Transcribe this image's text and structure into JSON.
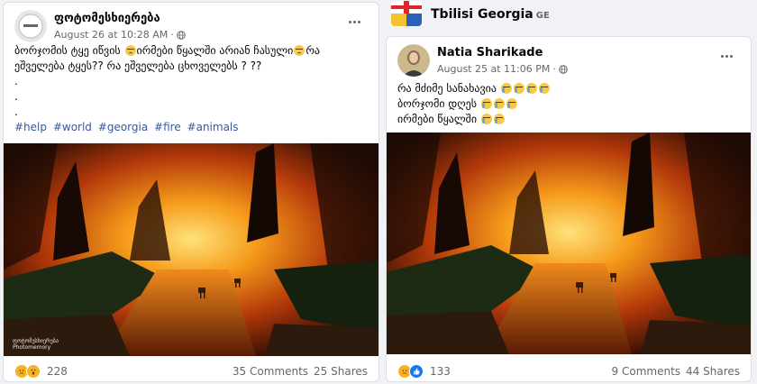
{
  "left_post": {
    "author": "ფოტომესხიერება",
    "timestamp": "August 26 at 10:28 AM",
    "text_lines": [
      "ბორჯომის ტყე იწვის",
      "ირმები წყალში არიან ჩასული",
      "რა",
      "ეშველება ტყეს?? რა ეშველება ცხოველებს ? ??",
      ".",
      ".",
      "."
    ],
    "hashtags": [
      "#help",
      "#world",
      "#georgia",
      "#fire",
      "#animals"
    ],
    "watermark_line1": "ფოტომესხიერება",
    "watermark_line2": "Photomemory",
    "reaction_count": "228",
    "comments": "35 Comments",
    "shares": "25 Shares"
  },
  "right_post": {
    "group_name": "Tbilisi Georgia",
    "group_code": "GE",
    "author": "Natia Sharikade",
    "timestamp": "August 25 at 11:06 PM",
    "line1": "რა მძიმე სანახავია",
    "line2": "ბორჯომი დღეს",
    "line3": "ირმები წყალში",
    "reaction_count": "133",
    "comments": "9 Comments",
    "shares": "44 Shares"
  },
  "icons": {
    "globe": "globe-icon",
    "more": "more-options-icon",
    "reaction_sad": "sad-reaction-icon",
    "reaction_wow": "wow-reaction-icon",
    "reaction_like": "like-reaction-icon"
  },
  "colors": {
    "link": "#385898",
    "meta": "#65676b",
    "fire_orange": "#f5a623",
    "background": "#f0f2f5"
  }
}
